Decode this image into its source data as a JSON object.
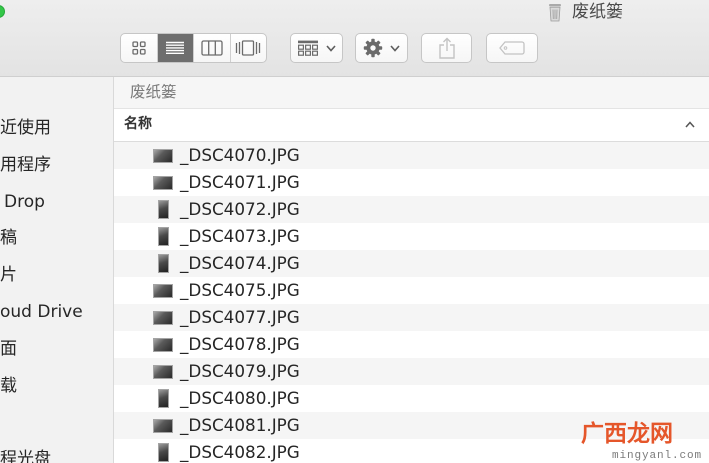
{
  "window": {
    "title": "废纸篓",
    "title_icon": "trash-icon"
  },
  "toolbar": {
    "view_buttons": [
      {
        "icon": "grid-icon",
        "selected": false
      },
      {
        "icon": "list-icon",
        "selected": true
      },
      {
        "icon": "columns-icon",
        "selected": false
      },
      {
        "icon": "cover-flow-icon",
        "selected": false
      }
    ],
    "arrange": {
      "icon": "arrange-icon",
      "chevron": "chevron-down-icon"
    },
    "action": {
      "icon": "gear-icon",
      "chevron": "chevron-down-icon"
    },
    "share": {
      "icon": "share-icon",
      "enabled": false
    },
    "tags": {
      "icon": "tag-icon",
      "enabled": false
    }
  },
  "sidebar": {
    "items": [
      {
        "label": "近使用"
      },
      {
        "label": "用程序"
      },
      {
        "label": "Drop"
      },
      {
        "label": "稿"
      },
      {
        "label": "片"
      },
      {
        "label": "oud Drive"
      },
      {
        "label": "面"
      },
      {
        "label": "载"
      },
      {
        "label": "程光盘"
      }
    ]
  },
  "path_bar": {
    "label": "废纸篓"
  },
  "list": {
    "column_header": "名称",
    "sort_icon": "chevron-up-icon",
    "files": [
      {
        "name": "_DSC4070.JPG",
        "icon": "photo-landscape-icon"
      },
      {
        "name": "_DSC4071.JPG",
        "icon": "photo-landscape-icon"
      },
      {
        "name": "_DSC4072.JPG",
        "icon": "photo-portrait-icon"
      },
      {
        "name": "_DSC4073.JPG",
        "icon": "photo-portrait-icon"
      },
      {
        "name": "_DSC4074.JPG",
        "icon": "photo-portrait-icon"
      },
      {
        "name": "_DSC4075.JPG",
        "icon": "photo-landscape-icon"
      },
      {
        "name": "_DSC4077.JPG",
        "icon": "photo-landscape-icon"
      },
      {
        "name": "_DSC4078.JPG",
        "icon": "photo-landscape-icon"
      },
      {
        "name": "_DSC4079.JPG",
        "icon": "photo-landscape-icon"
      },
      {
        "name": "_DSC4080.JPG",
        "icon": "photo-portrait-icon"
      },
      {
        "name": "_DSC4081.JPG",
        "icon": "photo-landscape-icon"
      },
      {
        "name": "_DSC4082.JPG",
        "icon": "photo-portrait-icon"
      }
    ]
  },
  "watermark": {
    "brand": "广西龙网",
    "url": "mingyanl.com"
  },
  "colors": {
    "toolbar_bg": "#e8e8e8",
    "sidebar_bg": "#f2f2f2",
    "selected_segment": "#6e6e6e",
    "row_stripe": "#f5f5f5",
    "watermark": "#e5562a",
    "traffic_green": "#33c748"
  }
}
